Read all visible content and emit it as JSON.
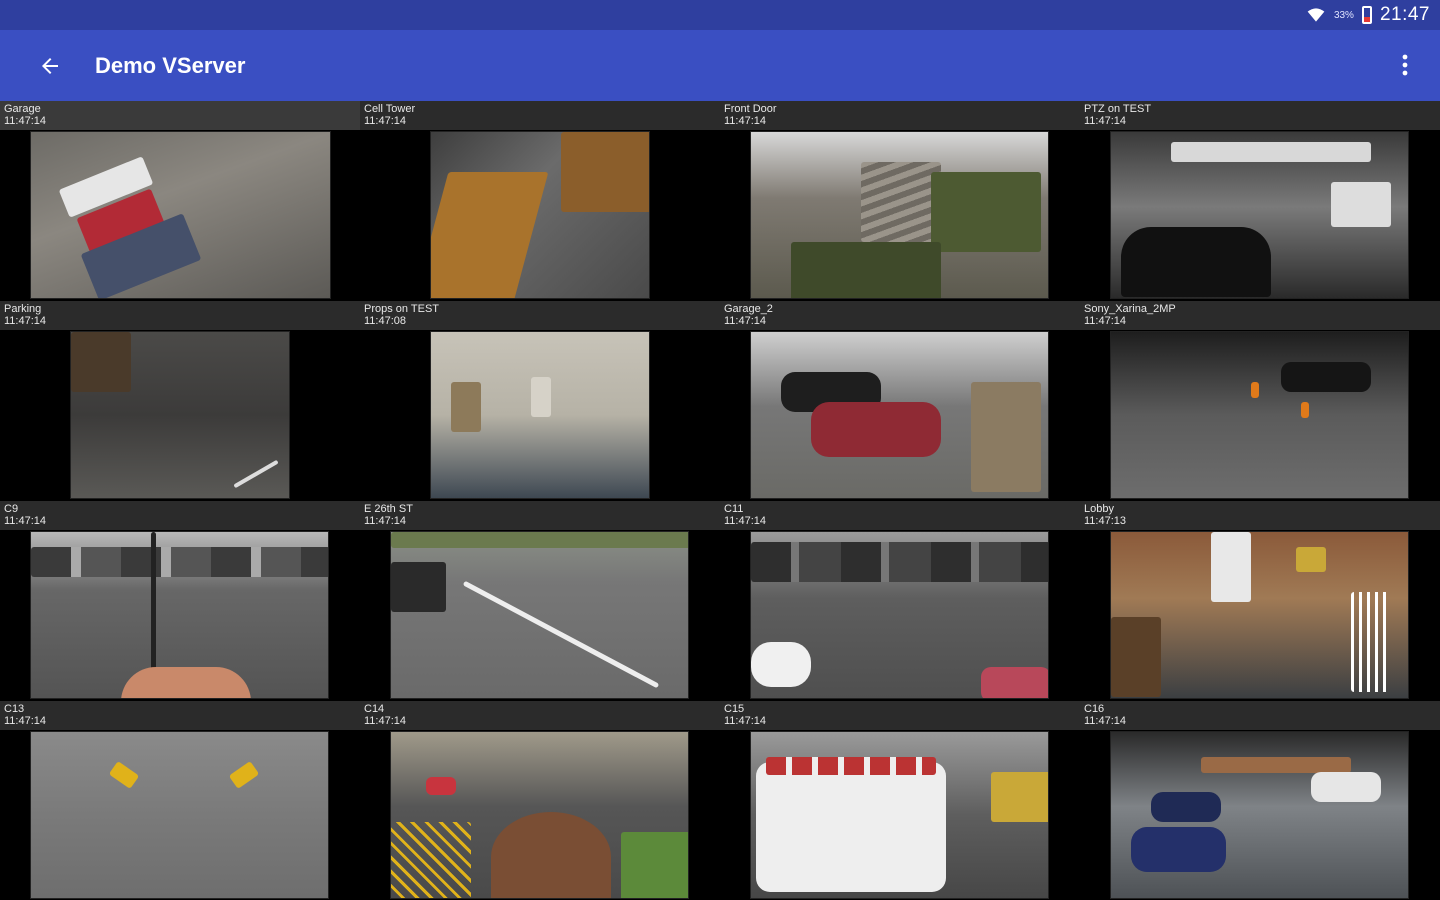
{
  "status_bar": {
    "battery_percent": "33%",
    "time": "21:47"
  },
  "app_bar": {
    "title": "Demo VServer"
  },
  "cameras": [
    {
      "name": "Garage",
      "time": "11:47:14"
    },
    {
      "name": "Cell Tower",
      "time": "11:47:14"
    },
    {
      "name": "Front Door",
      "time": "11:47:14"
    },
    {
      "name": "PTZ on TEST",
      "time": "11:47:14"
    },
    {
      "name": "Parking",
      "time": "11:47:14"
    },
    {
      "name": "Props on TEST",
      "time": "11:47:08"
    },
    {
      "name": "Garage_2",
      "time": "11:47:14"
    },
    {
      "name": "Sony_Xarina_2MP",
      "time": "11:47:14"
    },
    {
      "name": "C9",
      "time": "11:47:14"
    },
    {
      "name": "E 26th ST",
      "time": "11:47:14"
    },
    {
      "name": "C11",
      "time": "11:47:14"
    },
    {
      "name": "Lobby",
      "time": "11:47:13"
    },
    {
      "name": "C13",
      "time": "11:47:14"
    },
    {
      "name": "C14",
      "time": "11:47:14"
    },
    {
      "name": "C15",
      "time": "11:47:14"
    },
    {
      "name": "C16",
      "time": "11:47:14"
    }
  ],
  "colors": {
    "status_bar": "#2f3f9f",
    "app_bar": "#3a4fc2",
    "tile_header": "#2b2b2b",
    "background": "#000000"
  },
  "icons": {
    "back": "arrow-left-icon",
    "menu": "more-vert-icon",
    "wifi": "wifi-icon",
    "battery": "battery-icon"
  }
}
